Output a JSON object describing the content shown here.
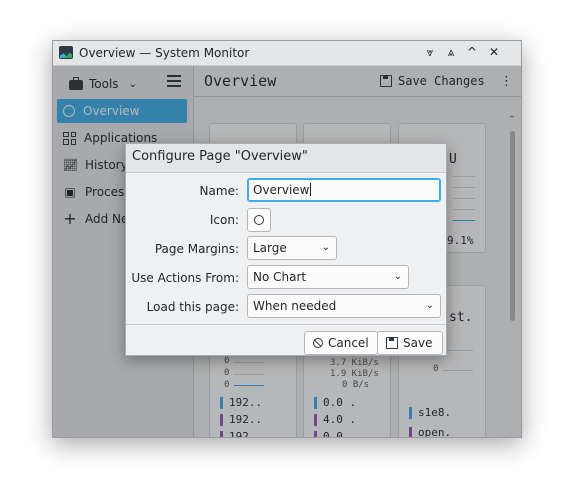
{
  "window": {
    "title": "Overview — System Monitor",
    "controls": [
      "⩔",
      "⩓",
      "^",
      "✕"
    ]
  },
  "sidebar": {
    "tools_label": "Tools",
    "items": [
      {
        "label": "Overview",
        "icon": "gauge-icon",
        "active": true
      },
      {
        "label": "Applications",
        "icon": "grid-icon",
        "active": false
      },
      {
        "label": "History",
        "icon": "chart-icon",
        "active": false
      },
      {
        "label": "Processes",
        "icon": "terminal-icon",
        "active": false
      },
      {
        "label": "Add New",
        "icon": "plus-icon",
        "active": false
      }
    ]
  },
  "main": {
    "title": "Overview",
    "save_label": "Save Changes",
    "card3_value": "9.1%",
    "card3_title_frag": "U",
    "card6_title_frag": "st.",
    "net_rx": "3.7 KiB/s",
    "net_tx": "1.9 KiB/s",
    "net_zero": "0 B/s",
    "zero": "0",
    "col1_rows": [
      "192..",
      "192..",
      "192.."
    ],
    "col2_rows": [
      "0.0 .",
      "4.0 .",
      "0.0 ."
    ],
    "col3_rows": [
      "s1e8.",
      "open."
    ]
  },
  "dialog": {
    "title": "Configure Page \"Overview\"",
    "name_label": "Name:",
    "name_value": "Overview",
    "icon_label": "Icon:",
    "margins_label": "Page Margins:",
    "margins_value": "Large",
    "actions_label": "Use Actions From:",
    "actions_value": "No Chart",
    "load_label": "Load this page:",
    "load_value": "When needed",
    "cancel_label": "Cancel",
    "save_label": "Save"
  },
  "colors": {
    "accent": "#3daee9",
    "purple": "#9b59b6"
  }
}
